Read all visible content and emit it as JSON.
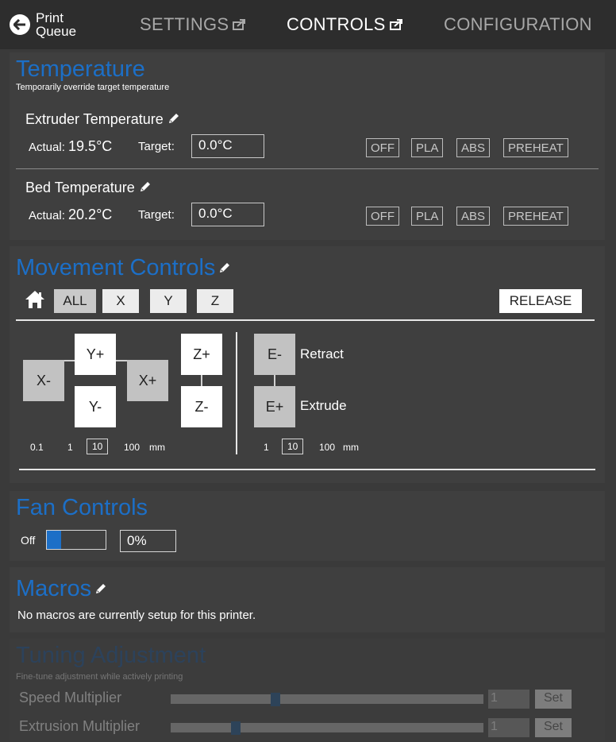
{
  "nav": {
    "back_line1": "Print",
    "back_line2": "Queue",
    "tabs": [
      {
        "label": "SETTINGS"
      },
      {
        "label": "CONTROLS"
      },
      {
        "label": "CONFIGURATION"
      }
    ]
  },
  "temperature": {
    "title": "Temperature",
    "subtitle": "Temporarily override target temperature",
    "extruder": {
      "label": "Extruder Temperature",
      "actual_label": "Actual:",
      "actual_value": "19.5°C",
      "target_label": "Target:",
      "target_value": "0.0°C"
    },
    "bed": {
      "label": "Bed Temperature",
      "actual_label": "Actual:",
      "actual_value": "20.2°C",
      "target_label": "Target:",
      "target_value": "0.0°C"
    },
    "presets": [
      "OFF",
      "PLA",
      "ABS",
      "PREHEAT"
    ]
  },
  "movement": {
    "title": "Movement Controls",
    "home_buttons": [
      "ALL",
      "X",
      "Y",
      "Z"
    ],
    "release_label": "RELEASE",
    "jog": {
      "y_plus": "Y+",
      "y_minus": "Y-",
      "x_minus": "X-",
      "x_plus": "X+",
      "z_plus": "Z+",
      "z_minus": "Z-",
      "e_minus": "E-",
      "e_plus": "E+"
    },
    "retract_label": "Retract",
    "extrude_label": "Extrude",
    "xyz_steps": [
      "0.1",
      "1",
      "10",
      "100"
    ],
    "xyz_unit": "mm",
    "xyz_selected": "10",
    "e_steps": [
      "1",
      "10",
      "100"
    ],
    "e_unit": "mm",
    "e_selected": "10"
  },
  "fan": {
    "title": "Fan Controls",
    "state_label": "Off",
    "speed_value": "0%",
    "slider_level": 0
  },
  "macros": {
    "title": "Macros",
    "message": "No macros are currently setup for this printer."
  },
  "tuning": {
    "title": "Tuning Adjustment",
    "subtitle": "Fine-tune adjustment while actively printing",
    "speed": {
      "label": "Speed Multiplier",
      "value": "1",
      "set_label": "Set",
      "slider_fraction": 0.33
    },
    "extrusion": {
      "label": "Extrusion Multiplier",
      "value": "1",
      "set_label": "Set",
      "slider_fraction": 0.2
    }
  },
  "colors": {
    "accent": "#1c6fc7",
    "background": "#3a3a3a",
    "panel": "#3f3f3f",
    "topbar": "#2d2d2d"
  }
}
